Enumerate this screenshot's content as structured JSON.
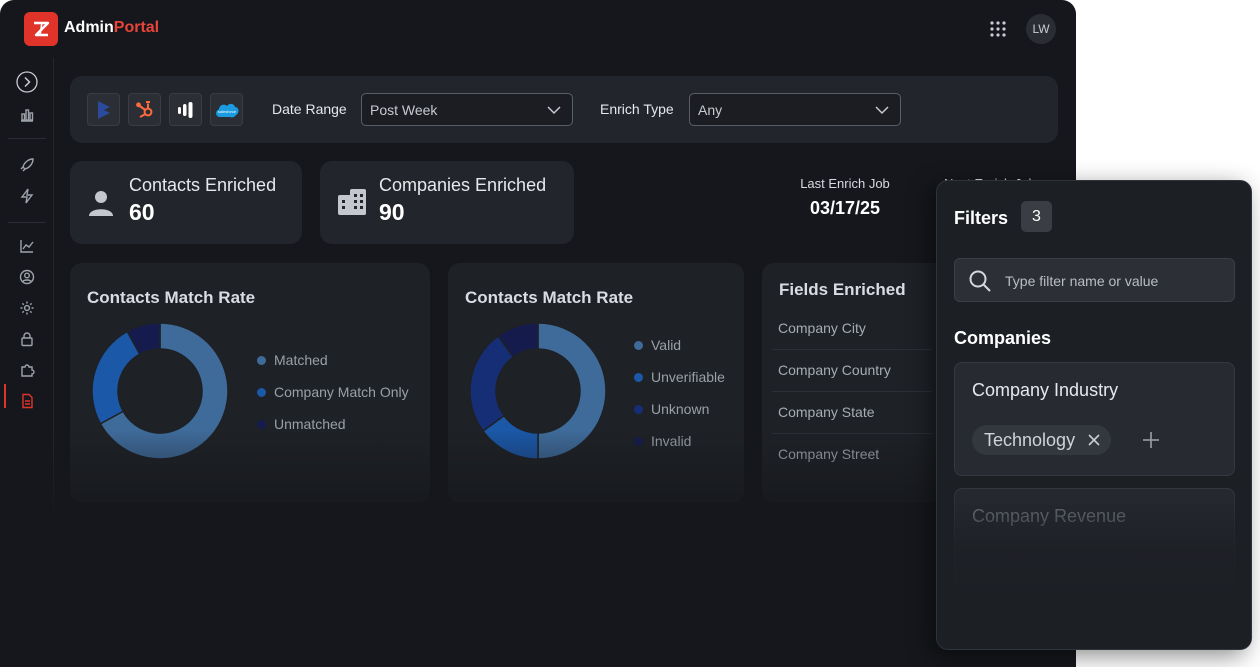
{
  "app": {
    "brand_main": "Admin",
    "brand_accent": "Portal",
    "user_initials": "LW"
  },
  "colors": {
    "accent": "#e0342b",
    "matched": "#3f6b9a",
    "company_match_only": "#1b58a8",
    "unmatched": "#151c4d",
    "valid": "#3f6b9a",
    "unverifiable": "#1b58a8",
    "unknown": "#162e75",
    "invalid": "#151c4d"
  },
  "sidebar": {
    "icons": [
      "expand-icon",
      "bar-chart-icon",
      "rocket-icon",
      "lightning-icon",
      "trend-chart-icon",
      "user-circle-icon",
      "gear-icon",
      "lock-icon",
      "puzzle-icon",
      "document-icon"
    ]
  },
  "toolbar": {
    "integrations": [
      "dynamics-icon",
      "hubspot-icon",
      "outreach-icon",
      "salesforce-icon"
    ],
    "date_range_label": "Date Range",
    "date_range_value": "Post Week",
    "enrich_type_label": "Enrich Type",
    "enrich_type_value": "Any"
  },
  "stats": {
    "contacts_label": "Contacts Enriched",
    "contacts_value": "60",
    "companies_label": "Companies Enriched",
    "companies_value": "90",
    "last_job_label": "Last Enrich Job",
    "last_job_value": "03/17/25",
    "next_job_label": "Next Enrich Job"
  },
  "panels": {
    "contacts_match_title": "Contacts Match Rate",
    "contacts_match_legend": [
      "Matched",
      "Company Match Only",
      "Unmatched"
    ],
    "email_match_title": "Contacts Match Rate",
    "email_match_legend": [
      "Valid",
      "Unverifiable",
      "Unknown",
      "Invalid"
    ],
    "fields_title": "Fields Enriched",
    "fields": [
      "Company City",
      "Company Country",
      "Company State",
      "Company Street"
    ]
  },
  "chart_data": [
    {
      "type": "pie",
      "title": "Contacts Match Rate",
      "categories": [
        "Matched",
        "Company Match Only",
        "Unmatched"
      ],
      "values": [
        67,
        25,
        8
      ]
    },
    {
      "type": "pie",
      "title": "Contacts Match Rate",
      "categories": [
        "Valid",
        "Unverifiable",
        "Unknown",
        "Invalid"
      ],
      "values": [
        50,
        15,
        25,
        10
      ]
    }
  ],
  "filters": {
    "title": "Filters",
    "count": "3",
    "search_placeholder": "Type filter name or value",
    "section": "Companies",
    "card1_title": "Company Industry",
    "card1_chip": "Technology",
    "card2_title": "Company Revenue"
  }
}
